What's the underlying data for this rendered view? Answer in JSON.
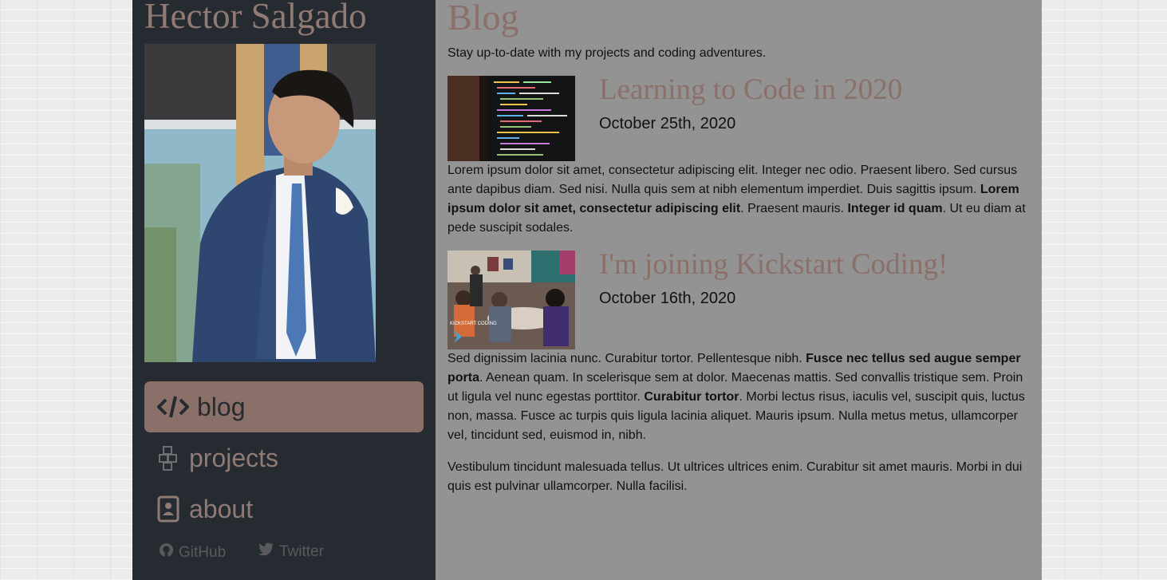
{
  "sidebar": {
    "site_title": "Hector Salgado",
    "nav": [
      {
        "label": "blog",
        "icon": "code-icon",
        "active": true
      },
      {
        "label": "projects",
        "icon": "cubes-icon",
        "active": false
      },
      {
        "label": "about",
        "icon": "address-card-icon",
        "active": false
      }
    ],
    "social": [
      {
        "label": "GitHub",
        "icon": "github-icon"
      },
      {
        "label": "Twitter",
        "icon": "twitter-icon"
      }
    ]
  },
  "main": {
    "title": "Blog",
    "tagline": "Stay up-to-date with my projects and coding adventures.",
    "posts": [
      {
        "title": "Learning to Code in 2020",
        "date": "October 25th, 2020",
        "paragraphs": [
          [
            {
              "text": "Lorem ipsum dolor sit amet, consectetur adipiscing elit. Integer nec odio. Praesent libero. Sed cursus ante dapibus diam. Sed nisi. Nulla quis sem at nibh elementum imperdiet. Duis sagittis ipsum. ",
              "bold": false
            },
            {
              "text": "Lorem ipsum dolor sit amet, consectetur adipiscing elit",
              "bold": true
            },
            {
              "text": ". Praesent mauris. ",
              "bold": false
            },
            {
              "text": "Integer id quam",
              "bold": true
            },
            {
              "text": ". Ut eu diam at pede suscipit sodales.",
              "bold": false
            }
          ]
        ]
      },
      {
        "title": "I'm joining Kickstart Coding!",
        "date": "October 16th, 2020",
        "thumb_caption": "KICKSTART CODING",
        "paragraphs": [
          [
            {
              "text": "Sed dignissim lacinia nunc. Curabitur tortor. Pellentesque nibh. ",
              "bold": false
            },
            {
              "text": "Fusce nec tellus sed augue semper porta",
              "bold": true
            },
            {
              "text": ". Aenean quam. In scelerisque sem at dolor. Maecenas mattis. Sed convallis tristique sem. Proin ut ligula vel nunc egestas porttitor. ",
              "bold": false
            },
            {
              "text": "Curabitur tortor",
              "bold": true
            },
            {
              "text": ". Morbi lectus risus, iaculis vel, suscipit quis, luctus non, massa. Fusce ac turpis quis ligula lacinia aliquet. Mauris ipsum. Nulla metus metus, ullamcorper vel, tincidunt sed, euismod in, nibh.",
              "bold": false
            }
          ],
          [
            {
              "text": "Vestibulum tincidunt malesuada tellus. Ut ultrices ultrices enim. Curabitur sit amet mauris. Morbi in dui quis est pulvinar ullamcorper. Nulla facilisi.",
              "bold": false
            }
          ]
        ]
      }
    ]
  },
  "colors": {
    "sidebar_bg": "#262a31",
    "accent": "#8a7068",
    "main_bg": "#939393"
  }
}
